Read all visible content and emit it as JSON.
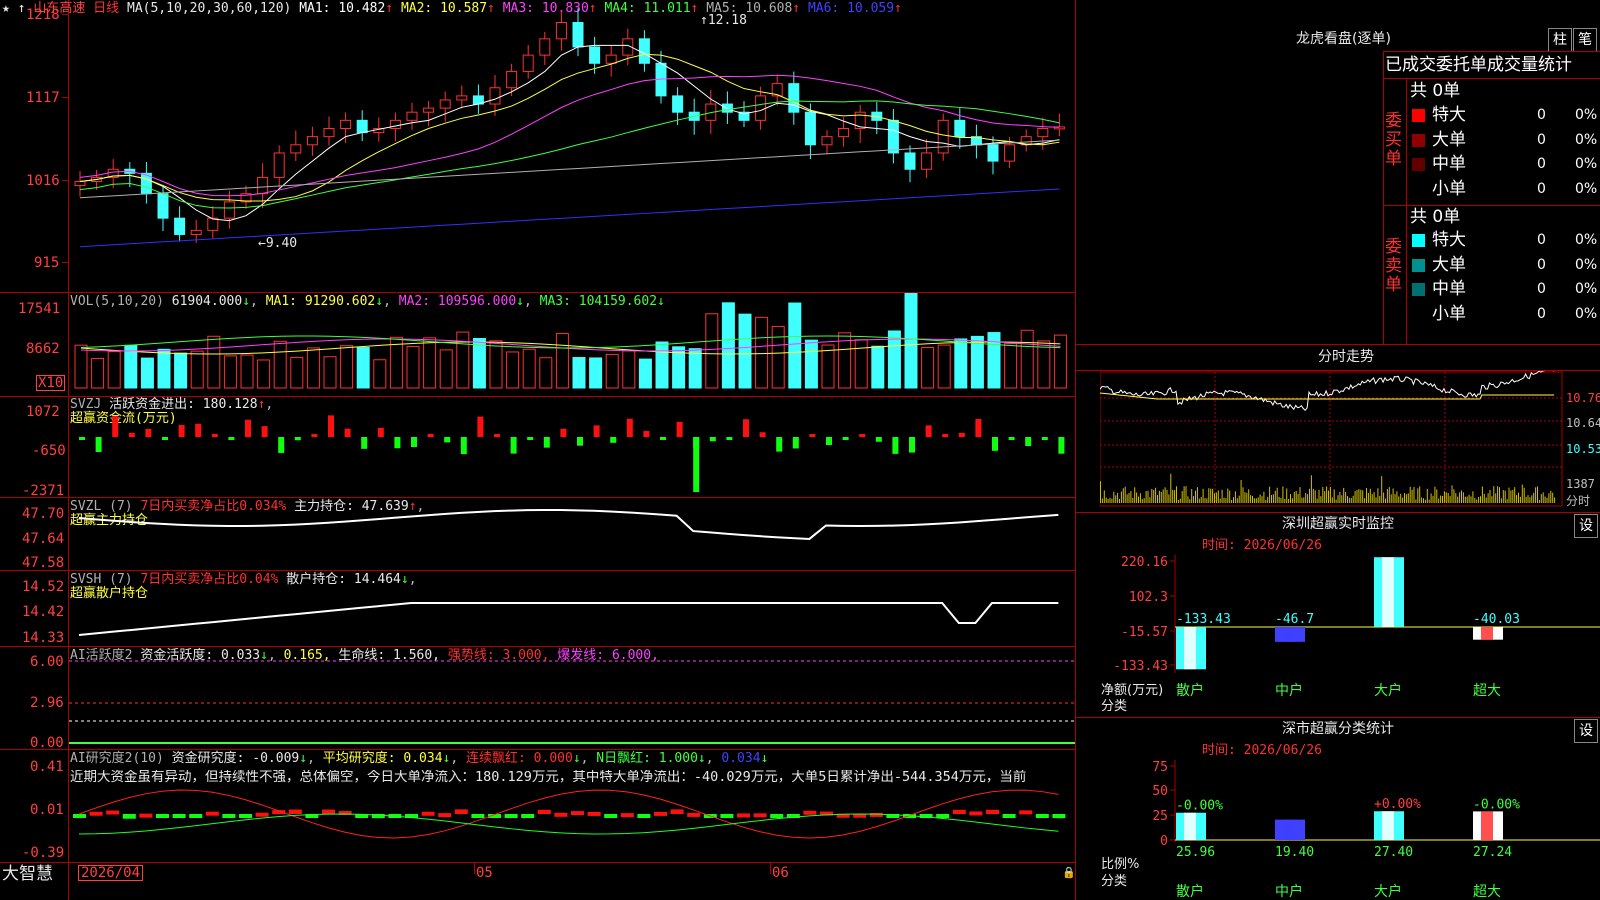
{
  "stock": {
    "name": "山东高速",
    "period": "日线",
    "ma_label": "MA(5,10,20,30,60,120)",
    "ma": [
      {
        "label": "MA1: 10.482",
        "color": "#ffffff"
      },
      {
        "label": "MA2: 10.587",
        "color": "#ffff40"
      },
      {
        "label": "MA3: 10.830",
        "color": "#ff40ff"
      },
      {
        "label": "MA4: 11.011",
        "color": "#40ff40"
      },
      {
        "label": "MA5: 10.608",
        "color": "#b0b0b0"
      },
      {
        "label": "MA6: 10.059",
        "color": "#4040ff"
      }
    ],
    "price_axis": [
      "1218",
      "1117",
      "1016",
      "915"
    ],
    "high_label": "12.18",
    "low_label": "9.40"
  },
  "vol": {
    "title": "VOL(5,10,20)",
    "value": "61904.000",
    "ma1": "MA1: 91290.602",
    "ma2": "MA2: 109596.000",
    "ma3": "MA3: 104159.602",
    "axis": [
      "17541",
      "8662"
    ],
    "unit": "X10"
  },
  "svzj": {
    "title": "SVZJ",
    "label": "活跃资金进出: 180.128",
    "subtitle": "超赢资金流(万元)",
    "axis": [
      "1072",
      "-650",
      "-2371"
    ]
  },
  "svzl": {
    "title": "SVZL (7)",
    "label1": "7日内买卖净占比0.034%",
    "label2": "主力持仓: 47.639",
    "subtitle": "超赢主力持仓",
    "axis": [
      "47.70",
      "47.64",
      "47.58"
    ]
  },
  "svsh": {
    "title": "SVSH (7)",
    "label1": "7日内买卖净占比0.04%",
    "label2": "散户持仓: 14.464",
    "subtitle": "超赢散户持仓",
    "axis": [
      "14.52",
      "14.42",
      "14.33"
    ]
  },
  "ai1": {
    "title": "AI活跃度2",
    "l1": "资金活跃度: 0.033",
    "l2": "0.165,",
    "l3": "生命线: 1.560,",
    "l4": "强势线: 3.000,",
    "l5": "爆发线: 6.000,",
    "axis": [
      "6.00",
      "2.96",
      "0.00"
    ]
  },
  "ai2": {
    "title": "AI研究度2(10)",
    "l1": "资金研究度: -0.009",
    "l2": "平均研究度: 0.034",
    "l3": "连续飘红: 0.000",
    "l4": "N日飘红: 1.000",
    "l5": "0.034",
    "text": "近期大资金虽有异动，但持续性不强，总体偏空，今日大单净流入：180.129万元，其中特大单净流出：-40.029万元，大单5日累计净出-544.354万元，当前",
    "axis": [
      "0.41",
      "0.01",
      "-0.39"
    ]
  },
  "bottom": {
    "brand": "大智慧",
    "date": "2026/04",
    "m5": "05",
    "m6": "06"
  },
  "right": {
    "lhb_title": "龙虎看盘(逐单)",
    "btn1": "柱",
    "btn2": "笔",
    "stat_title": "已成交委托单成交量统计",
    "buy_label": "委买单",
    "sell_label": "委卖单",
    "buy_total": "共 0单",
    "sell_total": "共 0单",
    "buy_rows": [
      {
        "name": "特大",
        "count": "0",
        "pct": "0%",
        "color": "#ff0000"
      },
      {
        "name": "大单",
        "count": "0",
        "pct": "0%",
        "color": "#900000"
      },
      {
        "name": "中单",
        "count": "0",
        "pct": "0%",
        "color": "#600000"
      },
      {
        "name": "小单",
        "count": "0",
        "pct": "0%",
        "color": ""
      }
    ],
    "sell_rows": [
      {
        "name": "特大",
        "count": "0",
        "pct": "0%",
        "color": "#00ffff"
      },
      {
        "name": "大单",
        "count": "0",
        "pct": "0%",
        "color": "#009090"
      },
      {
        "name": "中单",
        "count": "0",
        "pct": "0%",
        "color": "#007070"
      },
      {
        "name": "小单",
        "count": "0",
        "pct": "0%",
        "color": ""
      }
    ],
    "fs_title": "分时走势",
    "fs_axis": [
      "10.76",
      "10.64",
      "10.53"
    ],
    "fs_vol_axis": [
      "1387",
      "分时"
    ],
    "sz_title": "深圳超赢实时监控",
    "sz_btn": "设",
    "sz_time": "时间: 2026/06/26",
    "sz_axis": [
      "220.16",
      "102.3",
      "-15.57",
      "-133.43"
    ],
    "sz_ylabel": "净额(万元)",
    "sz_xlabel": "分类",
    "sz_bars": [
      {
        "name": "散户",
        "value": -133.43,
        "label": "-133.43"
      },
      {
        "name": "中户",
        "value": -46.7,
        "label": "-46.7"
      },
      {
        "name": "大户",
        "value": 220.16,
        "label": "220.16"
      },
      {
        "name": "超大",
        "value": -40.03,
        "label": "-40.03"
      }
    ],
    "sc_title": "深市超赢分类统计",
    "sc_btn": "设",
    "sc_time": "时间: 2026/06/26",
    "sc_axis": [
      "75",
      "50",
      "25",
      "0"
    ],
    "sc_ylabel": "比例%",
    "sc_xlabel": "分类",
    "sc_bars": [
      {
        "name": "散户",
        "value": 25.96,
        "label": "25.96",
        "delta": "-0.00%"
      },
      {
        "name": "中户",
        "value": 19.4,
        "label": "19.40",
        "delta": ""
      },
      {
        "name": "大户",
        "value": 27.4,
        "label": "27.40",
        "delta": "+0.00%"
      },
      {
        "name": "超大",
        "value": 27.24,
        "label": "27.24",
        "delta": "-0.00%"
      }
    ]
  }
}
